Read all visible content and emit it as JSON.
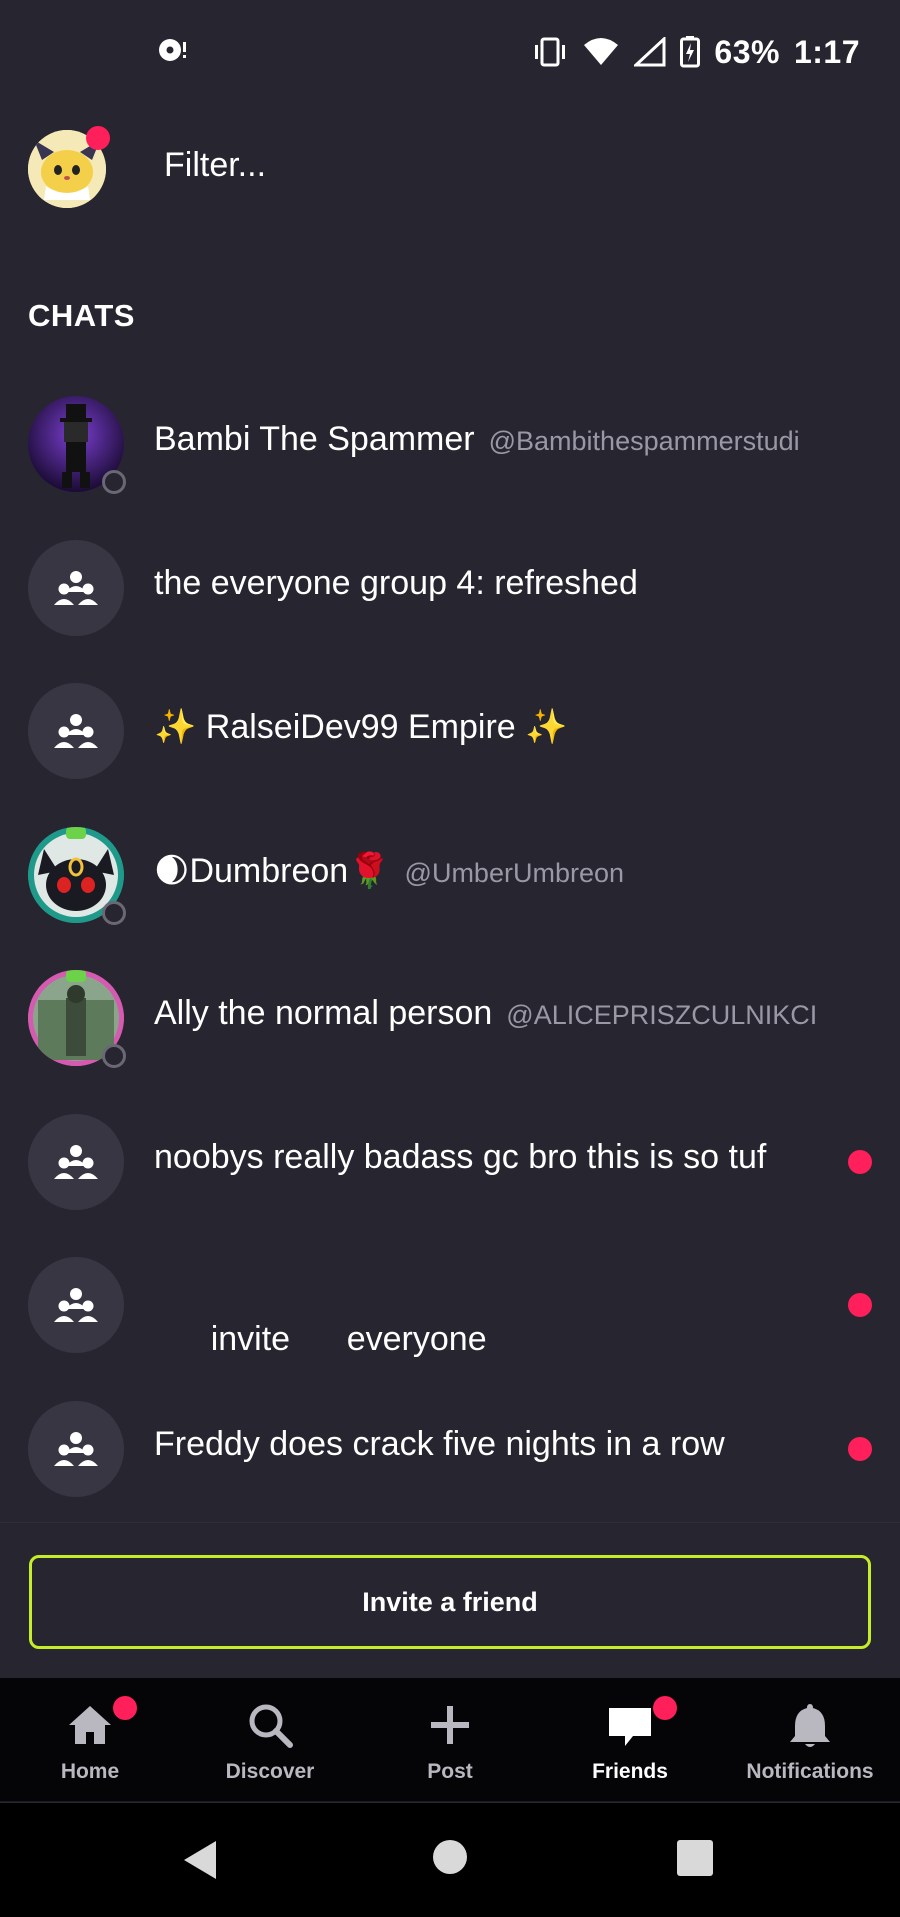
{
  "status_bar": {
    "battery": "63%",
    "time": "1:17"
  },
  "header": {
    "filter_placeholder": "Filter..."
  },
  "section_title": "CHATS",
  "chats": [
    {
      "name": "Bambi The Spammer",
      "handle": "@Bambithespammerstudi",
      "type": "user",
      "unread": false
    },
    {
      "name": "the everyone group 4: refreshed",
      "handle": "",
      "type": "group",
      "unread": false
    },
    {
      "name": "✨ RalseiDev99 Empire ✨",
      "handle": "",
      "type": "group",
      "unread": false
    },
    {
      "name": "🌒Dumbreon🌹",
      "handle": "@UmberUmbreon",
      "type": "user",
      "unread": false
    },
    {
      "name": "Ally the normal person",
      "handle": "@ALICEPRISZCULNIKCI",
      "type": "user",
      "unread": false
    },
    {
      "name": "noobys really badass gc bro this is so tuf",
      "handle": "",
      "type": "group",
      "unread": true
    },
    {
      "name": "invite      everyone",
      "handle": "",
      "type": "group",
      "unread": true
    },
    {
      "name": "Freddy does crack five nights in a row",
      "handle": "",
      "type": "group",
      "unread": true
    }
  ],
  "invite_button": "Invite a friend",
  "nav": {
    "home": "Home",
    "discover": "Discover",
    "post": "Post",
    "friends": "Friends",
    "notifications": "Notifications"
  },
  "colors": {
    "background": "#272530",
    "accent_lime": "#c6ee28",
    "unread_pink": "#ff1f5a",
    "nav_background": "#050507"
  }
}
